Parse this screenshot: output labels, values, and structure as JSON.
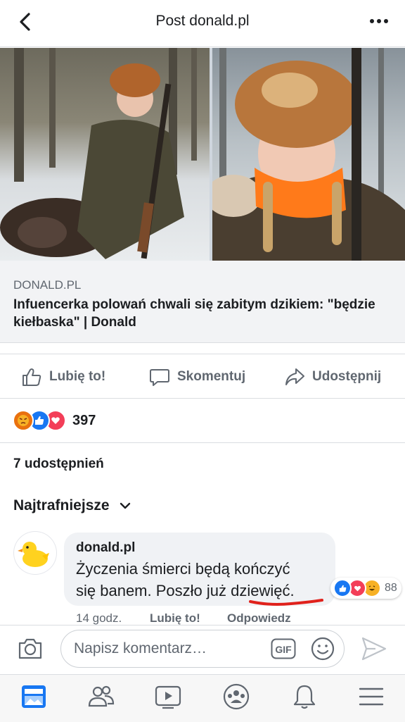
{
  "header": {
    "title": "Post donald.pl",
    "back_icon": "chevron-left-icon",
    "more_icon": "more-dots-icon"
  },
  "preview": {
    "domain": "DONALD.PL",
    "title": "Infuencerka polowań chwali się zabitym dzikiem: \"będzie kiełbaska\" | Donald"
  },
  "actions": {
    "like": "Lubię to!",
    "comment": "Skomentuj",
    "share": "Udostępnij"
  },
  "reactions": {
    "count": "397",
    "types": [
      "angry",
      "like",
      "love"
    ]
  },
  "shares_text": "7 udostępnień",
  "sort_label": "Najtrafniejsze",
  "comment": {
    "author": "donald.pl",
    "text_line1": "Życzenia śmierci będą kończyć",
    "text_line2": "się banem. Poszło już dziewięć.",
    "reaction_count": "88",
    "time": "14 godz.",
    "like_label": "Lubię to!",
    "reply_label": "Odpowiedz"
  },
  "composer": {
    "placeholder": "Napisz komentarz…",
    "gif_label": "GIF"
  },
  "colors": {
    "brand": "#1877f2",
    "text": "#1c1e21",
    "muted": "#606770",
    "underline": "#e0211b"
  }
}
